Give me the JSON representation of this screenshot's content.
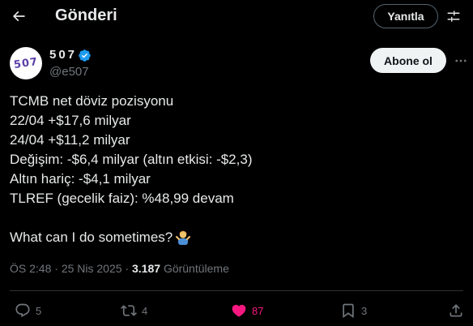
{
  "header": {
    "title": "Gönderi",
    "reply_button": "Yanıtla"
  },
  "author": {
    "name": "507",
    "handle": "@e507",
    "avatar_text": "507",
    "verified": true,
    "follow_button": "Abone ol"
  },
  "tweet": {
    "lines": [
      "TCMB net döviz pozisyonu",
      "22/04 +$17,6 milyar",
      "24/04 +$11,2 milyar",
      "Değişim: -$6,4 milyar (altın etkisi: -$2,3)",
      "Altın hariç: -$4,1 milyar",
      "TLREF (gecelik faiz): %48,99 devam"
    ],
    "closing": "What can I do sometimes?",
    "emoji_icon": "person-shrugging-icon"
  },
  "meta": {
    "time": "ÖS 2:48",
    "date": "25 Nis 2025",
    "views": "3.187",
    "views_label": "Görüntüleme"
  },
  "actions": {
    "replies": "5",
    "reposts": "4",
    "likes": "87",
    "bookmarks": "3"
  },
  "colors": {
    "background": "#000000",
    "text": "#e7e9ea",
    "muted": "#71767b",
    "like": "#f91880",
    "verified": "#1d9bf0",
    "divider": "#2f3336"
  }
}
